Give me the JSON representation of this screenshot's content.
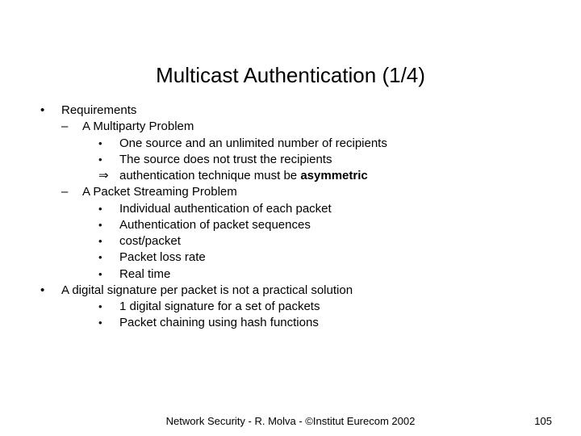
{
  "title": "Multicast Authentication (1/4)",
  "bullets": {
    "l1a": "Requirements",
    "l2a": "A Multiparty Problem",
    "l3a": "One source and an unlimited number of recipients",
    "l3b": "The source does not trust the recipients",
    "l3c_pre": "authentication technique must be ",
    "l3c_bold": "asymmetric",
    "l2b": "A Packet Streaming Problem",
    "l3d": "Individual authentication of each packet",
    "l3e": "Authentication of packet sequences",
    "l3f": "cost/packet",
    "l3g": "Packet loss rate",
    "l3h": "Real time",
    "l1b": "A digital signature per packet is not a practical solution",
    "l3i": "1 digital signature for a set of packets",
    "l3j": "Packet chaining using hash functions"
  },
  "footer": {
    "center": "Network Security  -  R. Molva  -  ©Institut Eurecom 2002",
    "page": "105"
  }
}
